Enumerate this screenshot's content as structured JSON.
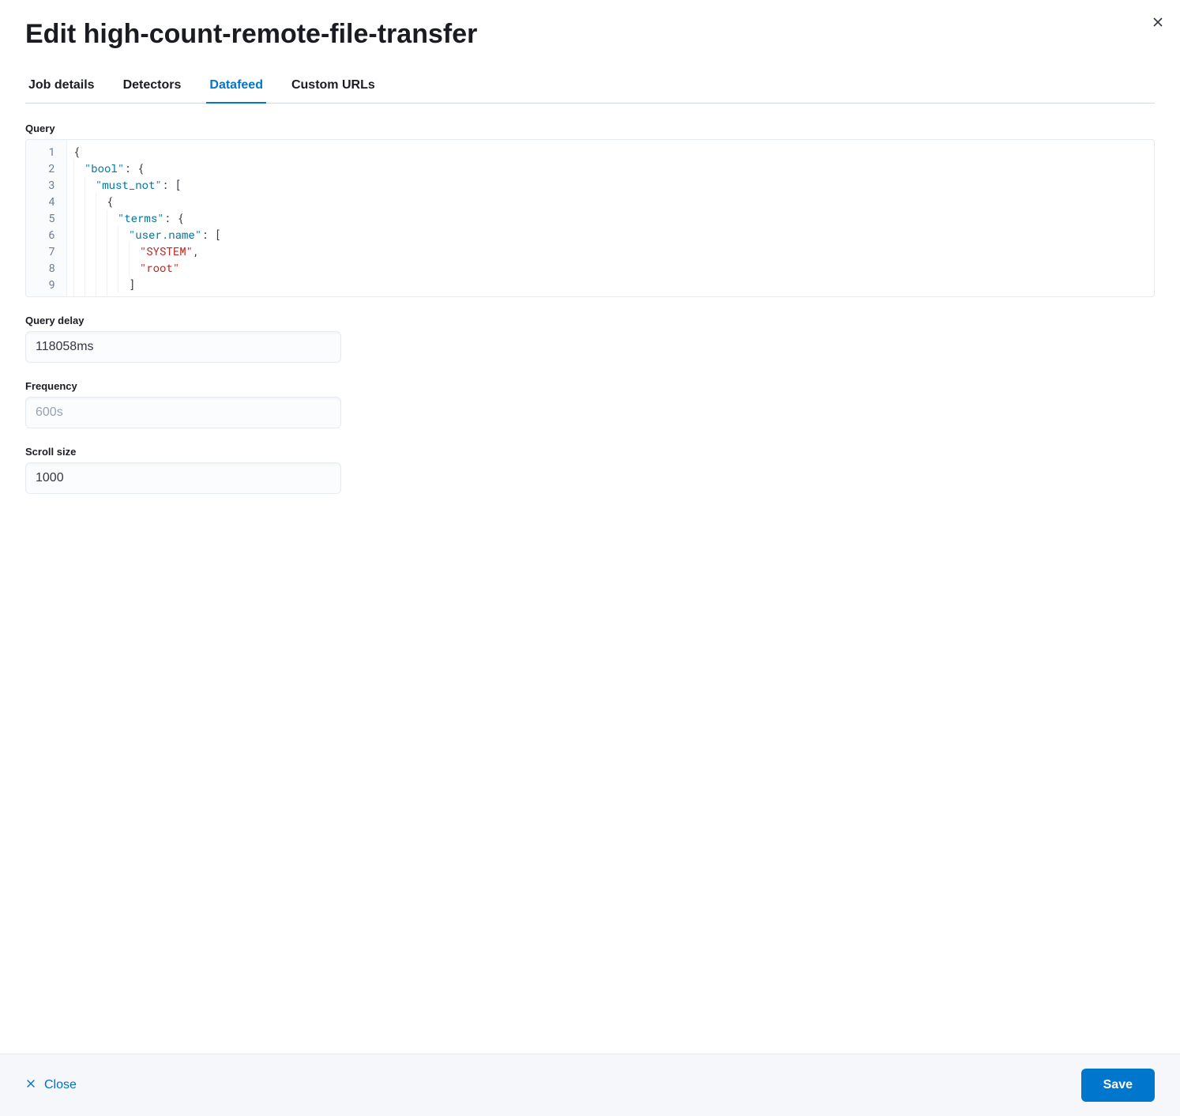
{
  "header": {
    "title": "Edit high-count-remote-file-transfer"
  },
  "tabs": [
    {
      "label": "Job details",
      "id": "job-details"
    },
    {
      "label": "Detectors",
      "id": "detectors"
    },
    {
      "label": "Datafeed",
      "id": "datafeed"
    },
    {
      "label": "Custom URLs",
      "id": "custom-urls"
    }
  ],
  "active_tab": "datafeed",
  "datafeed": {
    "query_label": "Query",
    "query_lines": [
      [
        {
          "t": "punc",
          "v": "{"
        }
      ],
      [
        {
          "t": "indent",
          "n": 1
        },
        {
          "t": "key",
          "v": "\"bool\""
        },
        {
          "t": "punc",
          "v": ": {"
        }
      ],
      [
        {
          "t": "indent",
          "n": 2
        },
        {
          "t": "key",
          "v": "\"must_not\""
        },
        {
          "t": "punc",
          "v": ": ["
        }
      ],
      [
        {
          "t": "indent",
          "n": 3
        },
        {
          "t": "punc",
          "v": "{"
        }
      ],
      [
        {
          "t": "indent",
          "n": 4
        },
        {
          "t": "key",
          "v": "\"terms\""
        },
        {
          "t": "punc",
          "v": ": {"
        }
      ],
      [
        {
          "t": "indent",
          "n": 5
        },
        {
          "t": "key",
          "v": "\"user.name\""
        },
        {
          "t": "punc",
          "v": ": ["
        }
      ],
      [
        {
          "t": "indent",
          "n": 6
        },
        {
          "t": "str",
          "v": "\"SYSTEM\""
        },
        {
          "t": "punc",
          "v": ","
        }
      ],
      [
        {
          "t": "indent",
          "n": 6
        },
        {
          "t": "str",
          "v": "\"root\""
        }
      ],
      [
        {
          "t": "indent",
          "n": 5
        },
        {
          "t": "punc",
          "v": "]"
        }
      ],
      [
        {
          "t": "indent",
          "n": 4
        },
        {
          "t": "punc",
          "v": "}"
        }
      ]
    ],
    "query_delay_label": "Query delay",
    "query_delay_value": "118058ms",
    "frequency_label": "Frequency",
    "frequency_placeholder": "600s",
    "scroll_size_label": "Scroll size",
    "scroll_size_value": "1000"
  },
  "footer": {
    "close_label": "Close",
    "save_label": "Save"
  }
}
